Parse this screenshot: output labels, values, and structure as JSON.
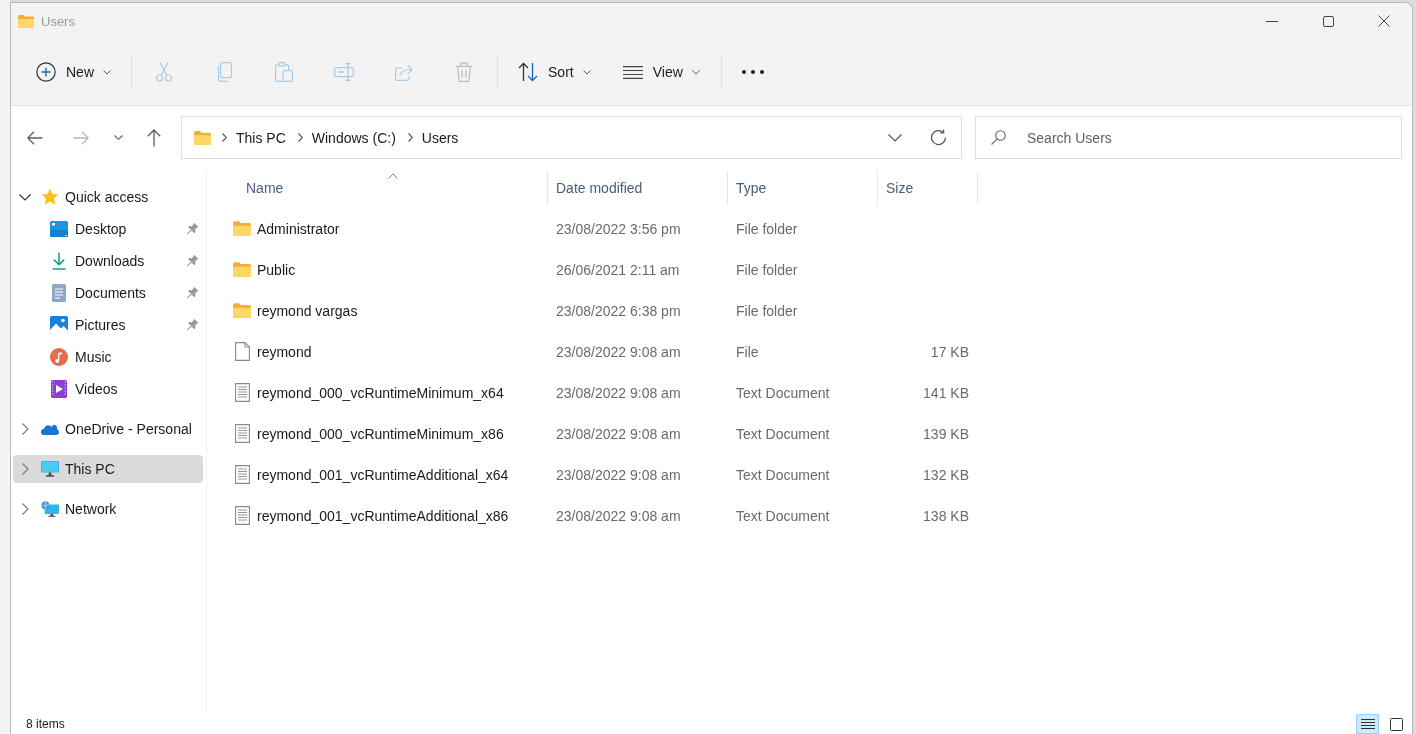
{
  "window": {
    "title": "Users"
  },
  "toolbar": {
    "new_button": {
      "label": "New"
    },
    "actions": [
      {
        "disabled": true
      },
      {
        "disabled": true
      },
      {
        "disabled": true
      },
      {
        "disabled": true
      },
      {
        "disabled": true
      },
      {
        "disabled": true
      }
    ],
    "sort_button": {
      "label": "Sort"
    },
    "view_button": {
      "label": "View"
    }
  },
  "navigation": {
    "buttons": [
      {
        "disabled": false
      },
      {
        "disabled": true
      },
      {
        "disabled": false
      },
      {
        "disabled": false
      }
    ]
  },
  "address_bar": {
    "path": [
      "This PC",
      "Windows (C:)",
      "Users"
    ]
  },
  "search": {
    "placeholder": "Search Users"
  },
  "sidebar": {
    "items": [
      {
        "label": "Quick access",
        "expanded": true,
        "selected": false,
        "children": [
          {
            "label": "Desktop",
            "pinned": true,
            "selected": false
          },
          {
            "label": "Downloads",
            "pinned": true,
            "selected": false
          },
          {
            "label": "Documents",
            "pinned": true,
            "selected": false
          },
          {
            "label": "Pictures",
            "pinned": true,
            "selected": false
          },
          {
            "label": "Music",
            "pinned": false,
            "selected": false
          },
          {
            "label": "Videos",
            "pinned": false,
            "selected": false
          }
        ]
      },
      {
        "label": "OneDrive - Personal",
        "expanded": false,
        "selected": false
      },
      {
        "label": "This PC",
        "expanded": false,
        "selected": true
      },
      {
        "label": "Network",
        "expanded": false,
        "selected": false
      }
    ]
  },
  "file_list": {
    "columns": [
      {
        "label": "Name",
        "sorted": true
      },
      {
        "label": "Date modified",
        "sorted": false
      },
      {
        "label": "Type",
        "sorted": false
      },
      {
        "label": "Size",
        "sorted": false
      }
    ],
    "rows": [
      {
        "kind": "folder",
        "name": "Administrator",
        "date_modified": "23/08/2022 3:56 pm",
        "type": "File folder"
      },
      {
        "kind": "folder",
        "name": "Public",
        "date_modified": "26/06/2021 2:11 am",
        "type": "File folder"
      },
      {
        "kind": "folder",
        "name": "reymond vargas",
        "date_modified": "23/08/2022 6:38 pm",
        "type": "File folder"
      },
      {
        "kind": "file",
        "name": "reymond",
        "date_modified": "23/08/2022 9:08 am",
        "type": "File",
        "size": "17 KB"
      },
      {
        "kind": "text",
        "name": "reymond_000_vcRuntimeMinimum_x64",
        "date_modified": "23/08/2022 9:08 am",
        "type": "Text Document",
        "size": "141 KB"
      },
      {
        "kind": "text",
        "name": "reymond_000_vcRuntimeMinimum_x86",
        "date_modified": "23/08/2022 9:08 am",
        "type": "Text Document",
        "size": "139 KB"
      },
      {
        "kind": "text",
        "name": "reymond_001_vcRuntimeAdditional_x64",
        "date_modified": "23/08/2022 9:08 am",
        "type": "Text Document",
        "size": "132 KB"
      },
      {
        "kind": "text",
        "name": "reymond_001_vcRuntimeAdditional_x86",
        "date_modified": "23/08/2022 9:08 am",
        "type": "Text Document",
        "size": "138 KB"
      }
    ]
  },
  "status_bar": {
    "item_count": "8 items",
    "views": [
      {
        "selected": true
      },
      {
        "selected": false
      }
    ]
  }
}
